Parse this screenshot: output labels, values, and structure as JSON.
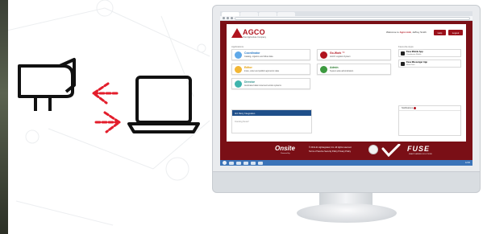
{
  "portal": {
    "logo_text": "AGCO",
    "logo_tagline": "Your Agriculture Company",
    "welcome_prefix": "Welcome to",
    "welcome_user": "Agro Link",
    "welcome_suffix": ", Jeffrey Smith",
    "help_label": "Help",
    "logout_label": "Logout",
    "applications_label": "Applications",
    "favorites_label": "Favourite Apps",
    "apps": [
      {
        "name": "Coordinator",
        "desc": "Catalog, organize and follow data",
        "color": "#5fa8e8",
        "name_color": "#2a79c4"
      },
      {
        "name": "Go-Work ™",
        "desc": "AGCO Logistics System",
        "color": "#b0141f",
        "name_color": "#b0141f"
      },
      {
        "name": "Editor",
        "desc": "Index, order and publish agronomic data",
        "color": "#f2b635",
        "name_color": "#e39b00"
      },
      {
        "name": "Admin",
        "desc": "System-wide administration",
        "color": "#3d9a40",
        "name_color": "#2e7d32"
      },
      {
        "name": "Director",
        "desc": "Automated data movement across systems",
        "color": "#3fb4ad",
        "name_color": "#2a8f89"
      }
    ],
    "favorites": [
      {
        "name": "Fuse Mobile App",
        "sub": "Coordinator Mobile"
      },
      {
        "name": "Fuse Messenger App",
        "sub": "Word Data"
      }
    ],
    "third_party_label": "3rd Party Integration",
    "third_party_status": "Coming Soon!",
    "notifications_label": "Notifications"
  },
  "footer": {
    "onsite_logo": "Onsite",
    "onsite_sub": "Powered by",
    "copyright": "© 2011-21 AgIntegrated, Inc. All rights reserved.",
    "links": "Terms of Service  Security Policy  Privacy Policy",
    "fuse_logo": "FUSE",
    "fuse_sub": "SMART FARMING SOLUTIONS"
  },
  "taskbar": {
    "clock": "12:00"
  },
  "colors": {
    "brand_red": "#b0141f",
    "portal_bg": "#7a0f16",
    "arrow_red": "#e31d2b"
  }
}
